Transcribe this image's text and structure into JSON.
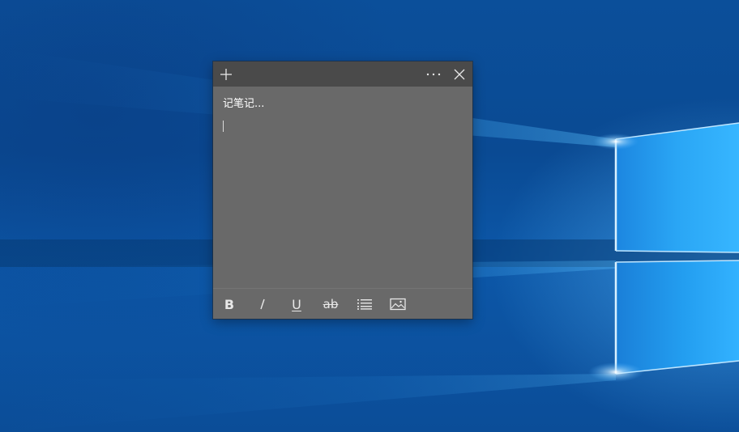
{
  "desktop": {
    "wallpaper": "windows-10-hero-light-panes",
    "accent_color": "#0b4f9a"
  },
  "note": {
    "background_color": "#696969",
    "titlebar_color": "#4a4a4a",
    "titlebar": {
      "add_icon": "plus-icon",
      "menu_icon": "ellipsis-icon",
      "close_icon": "close-icon"
    },
    "placeholder": "记笔记...",
    "toolbar": {
      "bold": {
        "label": "B",
        "icon": "bold-icon"
      },
      "italic": {
        "label": "I",
        "icon": "italic-icon"
      },
      "underline": {
        "label": "U",
        "icon": "underline-icon"
      },
      "strikethrough": {
        "label": "ab",
        "icon": "strikethrough-icon"
      },
      "bullets": {
        "icon": "bullet-list-icon"
      },
      "image": {
        "icon": "image-icon"
      }
    }
  }
}
